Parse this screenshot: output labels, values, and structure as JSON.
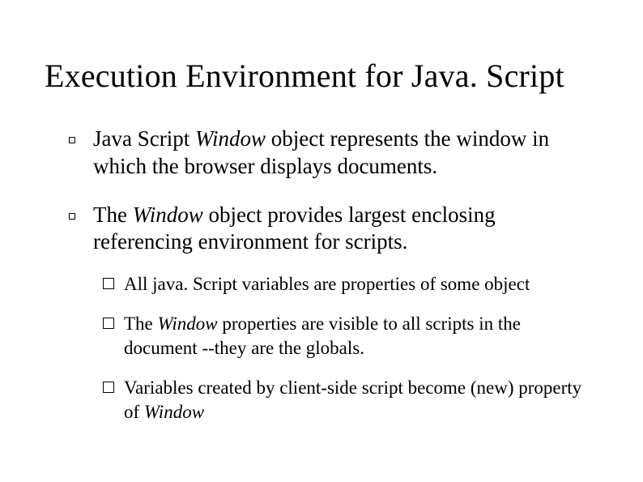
{
  "title": "Execution Environment for Java. Script",
  "bullets": [
    {
      "pre": "Java Script ",
      "em": "Window",
      "post": " object represents the window in which the browser displays documents."
    },
    {
      "pre": "The ",
      "em": "Window",
      "post": " object provides largest enclosing referencing environment for scripts.",
      "sub": [
        {
          "pre": "All java. Script variables are properties of some object",
          "em": "",
          "post": ""
        },
        {
          "pre": "The ",
          "em": "Window",
          "post": " properties are visible to all scripts in the document --they are the globals."
        },
        {
          "pre": "Variables created by client-side script become (new) property of ",
          "em": "Window",
          "post": ""
        }
      ]
    }
  ]
}
